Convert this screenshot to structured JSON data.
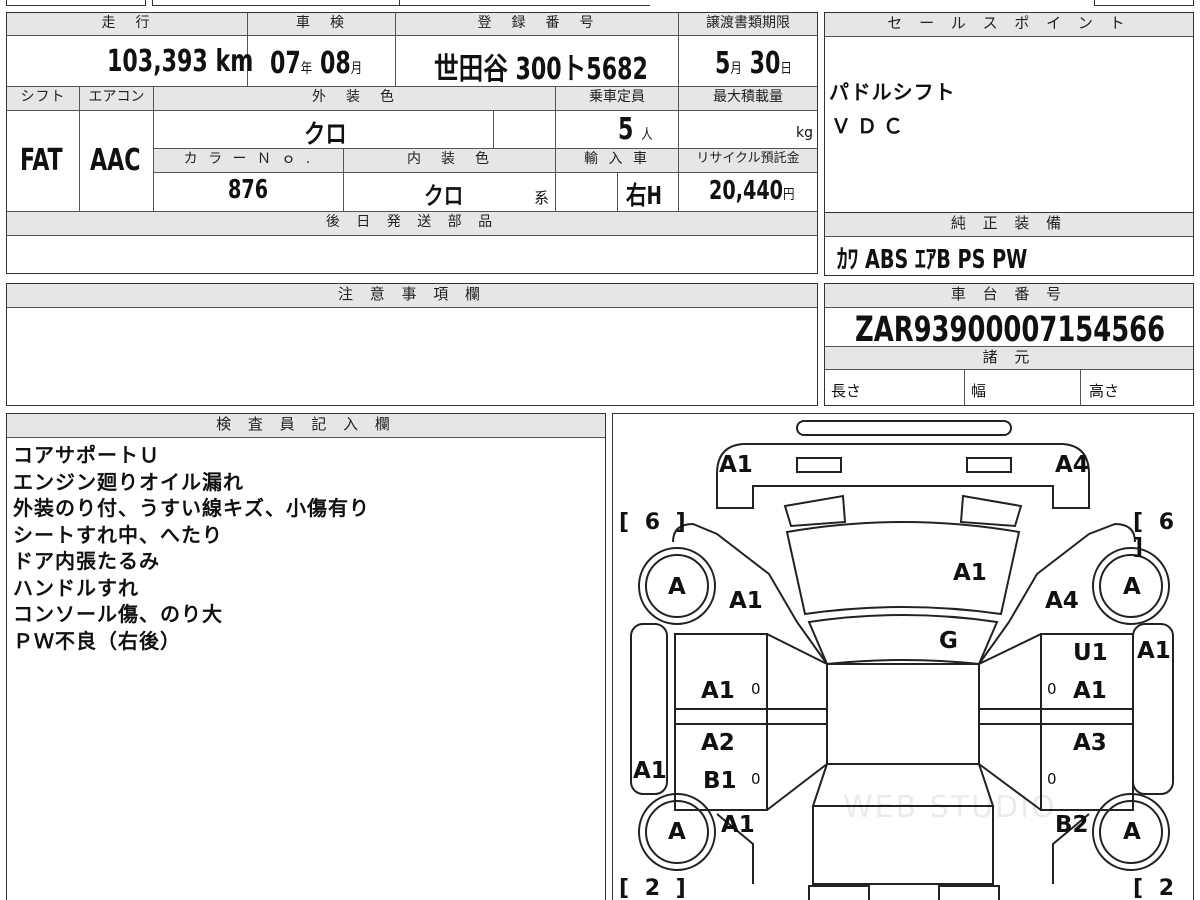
{
  "top_headers": {
    "mileage": "走　行",
    "inspection": "車　検",
    "registration": "登　録　番　号",
    "transfer_deadline": "譲渡書類期限",
    "sales_point": "セ ー ル ス ポ イ ン ト"
  },
  "values": {
    "mileage": "103,393",
    "mileage_unit": "km",
    "inspection_year": "07",
    "year_unit": "年",
    "inspection_month": "08",
    "month_unit": "月",
    "registration_number": "世田谷 300ト5682",
    "deadline_month": "5",
    "deadline_month_unit": "月",
    "deadline_day": "30",
    "deadline_day_unit": "日"
  },
  "row2_headers": {
    "shift": "シフト",
    "aircon": "エアコン",
    "exterior_color": "外　装　色",
    "capacity": "乗車定員",
    "max_load": "最大積載量"
  },
  "row2_values": {
    "shift": "FAT",
    "aircon": "AAC",
    "exterior_color": "クロ",
    "capacity": "5",
    "capacity_unit": "人",
    "load_unit": "kg"
  },
  "row3_headers": {
    "color_no": "カ ラ ー Ｎ ｏ .",
    "interior_color": "内　装　色",
    "import": "輸 入 車",
    "recycle_fee": "リサイクル預託金"
  },
  "row3_values": {
    "color_no": "876",
    "interior_color": "クロ",
    "interior_suffix": "系",
    "import": "右H",
    "recycle_fee": "20,440",
    "yen": "円"
  },
  "sales_points": [
    "パドルシフト",
    "ＶＤＣ"
  ],
  "later_parts": {
    "header": "後 日 発 送 部 品"
  },
  "equipment": {
    "header": "純 正 装 備",
    "items": "ｶﾜ ABS ｴｱB PS PW"
  },
  "notes": {
    "header": "注 意 事 項 欄"
  },
  "chassis": {
    "header": "車 台 番 号",
    "number": "ZAR93900007154566"
  },
  "specs": {
    "header": "諸 元",
    "length": "長さ",
    "width": "幅",
    "height": "高さ"
  },
  "inspector": {
    "header": "検 査 員 記 入 欄",
    "lines": [
      "コアサポートＵ",
      "エンジン廻りオイル漏れ",
      "外装のり付、うすい線キズ、小傷有り",
      "シートすれ中、へたり",
      "ドア内張たるみ",
      "ハンドルすれ",
      "コンソール傷、のり大",
      "ＰＷ不良（右後）"
    ]
  },
  "damage_map": {
    "tire_left_front": "[ 6 ]",
    "tire_right_front": "[ 6 ]",
    "tire_left_rear": "[ 2 ]",
    "tire_right_rear": "[ 2 ]",
    "wheel_fl": "A",
    "wheel_fr": "A",
    "wheel_rl": "A",
    "wheel_rr": "A",
    "front_bumper_left": "A1",
    "front_bumper_right": "A4",
    "fender_left_front": "A1",
    "fender_right_front": "A4",
    "hood": "A1",
    "windshield": "G",
    "door_lf": "A1",
    "door_rf_top": "U1",
    "door_rf": "A1",
    "door_lr": "A2",
    "door_lr_b": "B1",
    "door_rr": "A3",
    "sill_right": "A1",
    "sill_left": "A1",
    "fender_left_rear": "A1",
    "fender_right_rear": "B2",
    "zero": "0",
    "watermark": "WEB STUDIO"
  }
}
